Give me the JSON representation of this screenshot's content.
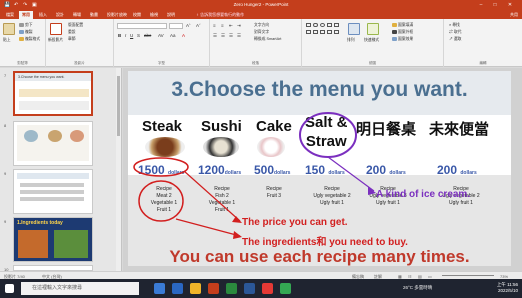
{
  "titlebar": {
    "title": "Zero Hunger2 - PowerPoint",
    "autosave_icon": "save-icon",
    "undo_icon": "undo-icon",
    "redo_icon": "redo-icon",
    "minimize": "–",
    "restore": "□",
    "close": "✕"
  },
  "tabs": [
    "檔案",
    "常用",
    "插入",
    "設計",
    "轉場",
    "動畫",
    "投影片放映",
    "校閱",
    "檢視",
    "說明"
  ],
  "tell_me": "♀ 告訴我您想要執行的動作",
  "share": "共用",
  "ribbon": {
    "paste": "貼上",
    "cut": "剪下",
    "copy": "複製",
    "format_painter": "複製格式",
    "clipboard_group": "剪貼簿",
    "new_slide": "新投影片",
    "layout": "版面配置",
    "reset": "重設",
    "section": "章節",
    "slides_group": "投影片",
    "font_name": "",
    "font_size": "",
    "font_group": "字型",
    "text_direction": "文字方向",
    "align_text": "對齊文字",
    "smartart": "轉換成 SmartArt",
    "paragraph_group": "段落",
    "arrange": "排列",
    "quick_styles": "快速樣式",
    "drawing_group": "繪圖",
    "shape_fill": "圖案填滿",
    "shape_outline": "圖案外框",
    "shape_effects": "圖案效果",
    "find": "尋找",
    "replace": "取代",
    "select": "選取",
    "editing_group": "編輯"
  },
  "thumbnails": [
    {
      "num": "7",
      "title": "3.Choose the menu you want."
    },
    {
      "num": "8",
      "title": ""
    },
    {
      "num": "9",
      "title": ""
    },
    {
      "num": "9",
      "title": "1.Ingredients today"
    },
    {
      "num": "10",
      "title": ""
    }
  ],
  "slide": {
    "title": "3.Choose the menu you want.",
    "items": [
      {
        "name": "Steak",
        "price": "1500",
        "unit": "dollars",
        "recipe": [
          "Recipe",
          "Meat  2",
          "Vegetable  1",
          "Fruit  1"
        ]
      },
      {
        "name": "Sushi",
        "price": "1200",
        "unit": "dollars",
        "recipe": [
          "Recipe",
          "Fish  2",
          "Vegetable  1",
          "Fruit  1"
        ]
      },
      {
        "name": "Cake",
        "price": "500",
        "unit": "dollars",
        "recipe": [
          "Recipe",
          "Fruit  3"
        ]
      },
      {
        "name": "Salt &",
        "name2": "Straw",
        "price": "150",
        "unit": "dollars",
        "recipe": [
          "Recipe",
          "Ugly vegetable  2",
          "Ugly fruit  1"
        ]
      },
      {
        "name": "明日餐桌",
        "price": "200",
        "unit": "dollars",
        "recipe": [
          "Recipe",
          "Ugly vegetable  3",
          "Ugly fruit  1"
        ]
      },
      {
        "name": "未來便當",
        "price": "200",
        "unit": "dollars",
        "recipe": [
          "Recipe",
          "Ugly vegetable  2",
          "Ugly fruit  1"
        ]
      }
    ],
    "note_price": "The price you can get.",
    "note_icecream": "A kind of ice cream.",
    "note_ingredients": "The ingredients和 you need to buy.",
    "bottom": "You can use each recipe many times."
  },
  "status": {
    "slide_count": "投影片 7/40",
    "language": "中文 (台灣)",
    "notes": "備忘稿",
    "comments": "註解",
    "zoom": "73%"
  },
  "taskbar": {
    "search_placeholder": "在這裡輸入文字來搜尋",
    "weather": "26°C 多雲時晴",
    "time": "上午 11:56",
    "date": "2022/5/10"
  },
  "colors": {
    "accent": "#c43e1c",
    "title_blue": "#4a6f90",
    "price_blue": "#3a58a8",
    "annotation_red": "#d21f1f",
    "annotation_purple": "#7b2fbf"
  }
}
